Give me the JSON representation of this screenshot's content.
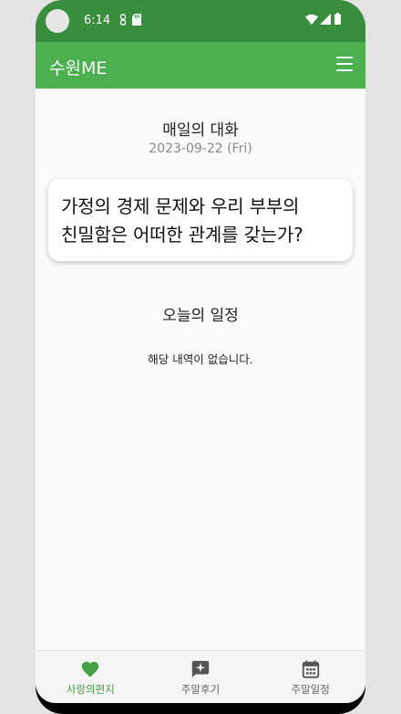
{
  "status_bar": {
    "time": "6:14"
  },
  "app_bar": {
    "title": "수원ME"
  },
  "daily": {
    "title": "매일의 대화",
    "date": "2023-09-22 (Fri)",
    "question_line1": "가정의 경제 문제와 우리 부부의",
    "question_line2": "친밀함은 어떠한 관계를 갖는가?"
  },
  "schedule": {
    "title": "오늘의 일정",
    "empty_message": "해당 내역이 없습니다."
  },
  "bottom_nav": {
    "items": [
      {
        "label": "사랑의편지",
        "icon": "heart-icon",
        "active": true
      },
      {
        "label": "주말후기",
        "icon": "review-sparkle-icon",
        "active": false
      },
      {
        "label": "주말일정",
        "icon": "calendar-icon",
        "active": false
      }
    ]
  },
  "colors": {
    "status_bar": "#388e3c",
    "app_bar": "#4caf50",
    "accent": "#43a047",
    "inactive_icon": "#555555"
  }
}
